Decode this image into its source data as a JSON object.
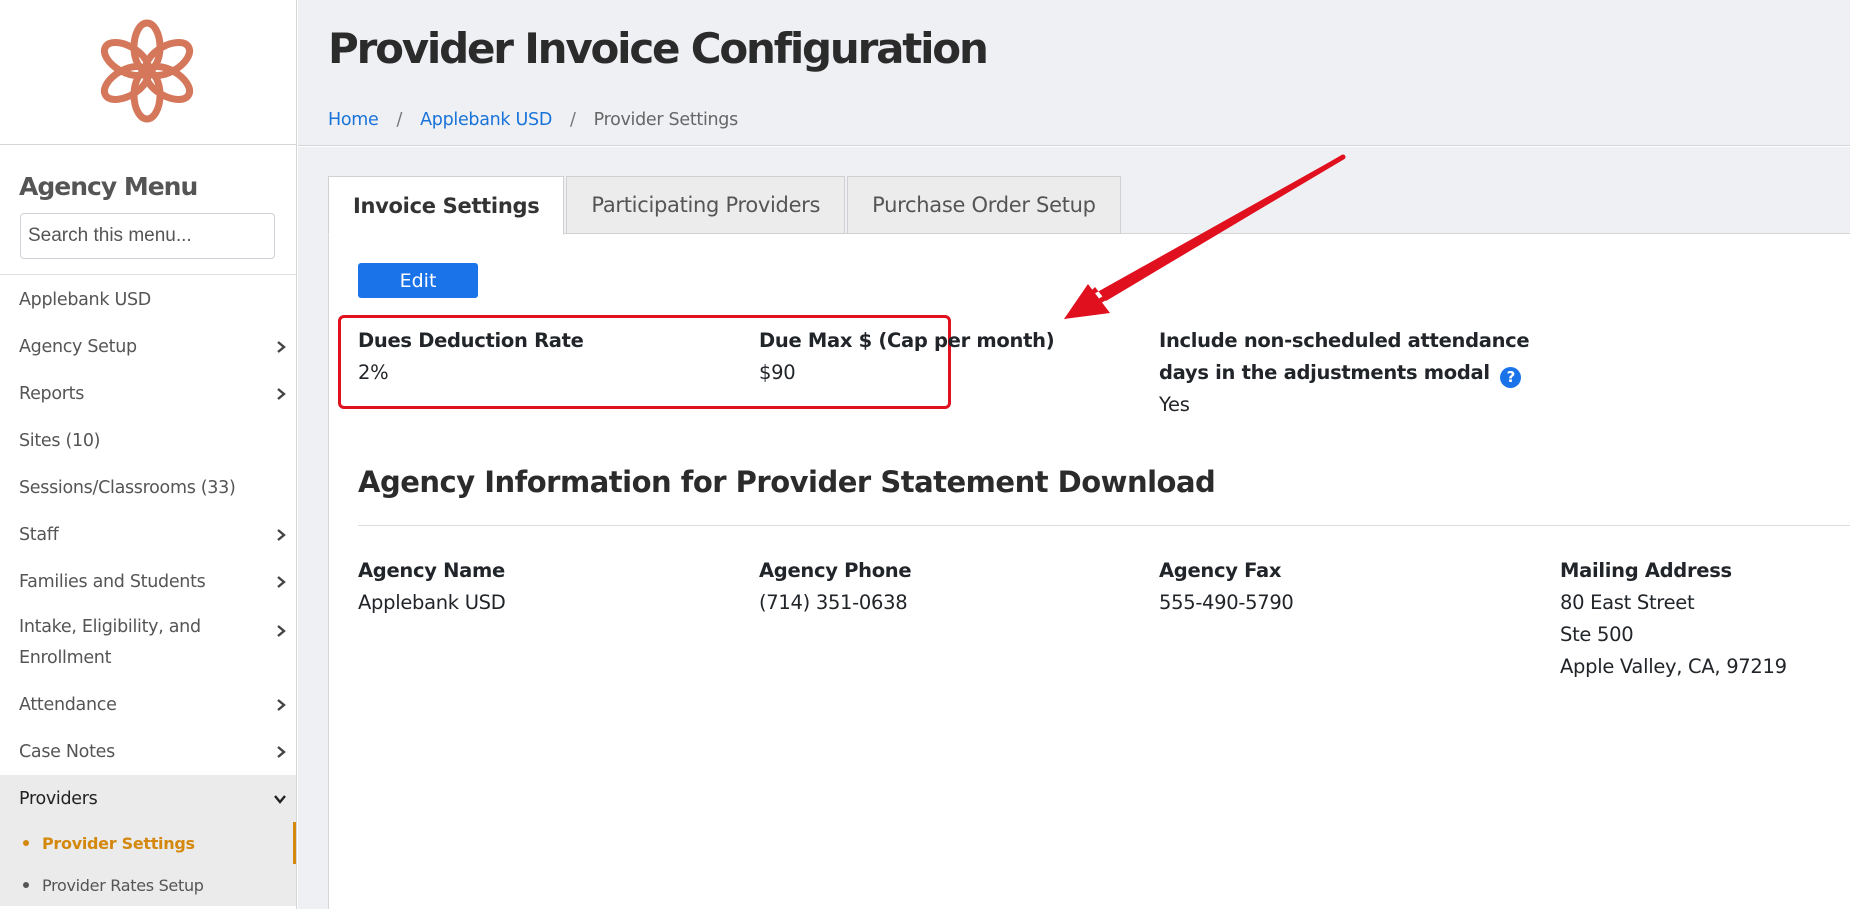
{
  "sidebar": {
    "menu_title": "Agency Menu",
    "search_placeholder": "Search this menu...",
    "items": [
      {
        "label": "Applebank USD",
        "chevron": false
      },
      {
        "label": "Agency Setup",
        "chevron": true
      },
      {
        "label": "Reports",
        "chevron": true
      },
      {
        "label": "Sites (10)",
        "chevron": false
      },
      {
        "label": "Sessions/Classrooms (33)",
        "chevron": false
      },
      {
        "label": "Staff",
        "chevron": true
      },
      {
        "label": "Families and Students",
        "chevron": true
      },
      {
        "label": "Intake, Eligibility, and Enrollment",
        "chevron": true
      },
      {
        "label": "Attendance",
        "chevron": true
      },
      {
        "label": "Case Notes",
        "chevron": true
      },
      {
        "label": "Providers",
        "chevron": true,
        "expanded": true
      }
    ],
    "sub_items": [
      {
        "label": "Provider Settings",
        "active": true
      },
      {
        "label": "Provider Rates Setup",
        "active": false
      }
    ]
  },
  "header": {
    "title": "Provider Invoice Configuration",
    "breadcrumb": {
      "home": "Home",
      "agency": "Applebank USD",
      "current": "Provider Settings",
      "separator": "/"
    }
  },
  "tabs": [
    {
      "label": "Invoice Settings",
      "active": true
    },
    {
      "label": "Participating Providers",
      "active": false
    },
    {
      "label": "Purchase Order Setup",
      "active": false
    }
  ],
  "invoice_settings": {
    "edit_label": "Edit",
    "dues_deduction_rate": {
      "label": "Dues Deduction Rate",
      "value": "2%"
    },
    "due_max": {
      "label": "Due Max $ (Cap per month)",
      "value": "$90"
    },
    "non_scheduled": {
      "label_line1": "Include non-scheduled attendance",
      "label_line2": "days in the adjustments modal",
      "help_glyph": "?",
      "value": "Yes"
    }
  },
  "agency_info": {
    "section_title": "Agency Information for Provider Statement Download",
    "agency_name": {
      "label": "Agency Name",
      "value": "Applebank USD"
    },
    "agency_phone": {
      "label": "Agency Phone",
      "value": "(714) 351-0638"
    },
    "agency_fax": {
      "label": "Agency Fax",
      "value": "555-490-5790"
    },
    "mailing_address": {
      "label": "Mailing Address",
      "line1": "80 East Street",
      "line2": "Ste 500",
      "line3": "Apple Valley, CA, 97219"
    }
  },
  "colors": {
    "accent": "#1a73e8",
    "active_menu": "#d4880e",
    "logo": "#d4775a",
    "highlight": "#e0101e"
  },
  "icons": {
    "chevron_right": "chevron-right-icon",
    "chevron_down": "chevron-down-icon",
    "help": "question-circle-icon",
    "logo": "flower-logo-icon"
  }
}
